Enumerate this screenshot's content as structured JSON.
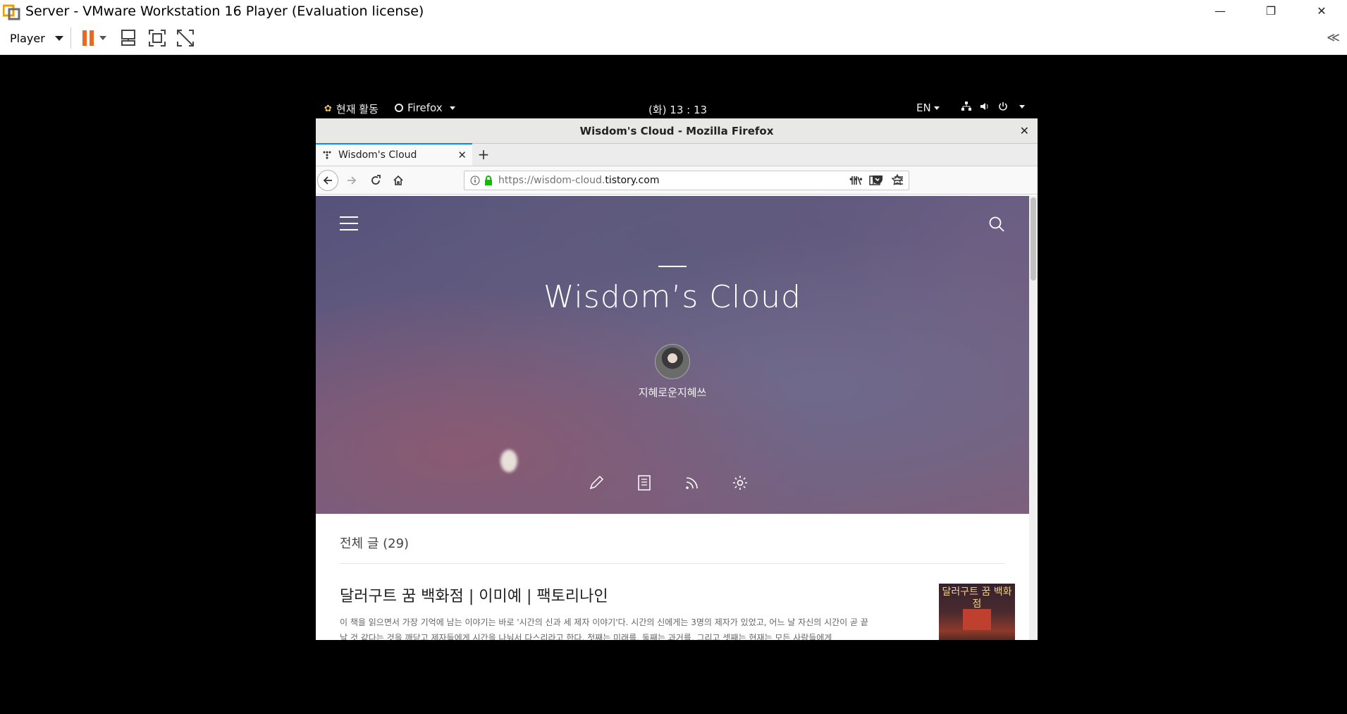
{
  "vm": {
    "title": "Server - VMware Workstation 16 Player (Evaluation license)",
    "player_label": "Player",
    "collapse_label": "≪"
  },
  "gnome": {
    "activities": "현재 활동",
    "app_menu": "Firefox",
    "clock": "(화) 13 : 13",
    "lang": "EN"
  },
  "firefox": {
    "window_title": "Wisdom's Cloud - Mozilla Firefox",
    "tab_label": "Wisdom's Cloud",
    "url_prefix": "https://wisdom-cloud.",
    "url_domain": "tistory.com",
    "url_actions": "•••"
  },
  "blog": {
    "title": "Wisdom’s Cloud",
    "author": "지혜로운지혜쓰",
    "count": "전체 글 (29)",
    "post": {
      "title": "달러구트 꿈 백화점 | 이미예 | 팩토리나인",
      "excerpt": "이 책을 읽으면서 가장 기억에 남는 이야기는 바로 '시간의 신과 세 제자 이야기'다. 시간의 신에게는 3명의 제자가 있었고, 어느 날 자신의 시간이 곧 끝날 것 같다는 것을 깨닫고 제자들에게 시간을 나눠서 다스리라고 한다. 첫째는 미래를, 둘째는 과거를, 그리고 셋째는 현재는 모든 사람들에게",
      "thumb_text": "달러구트 꿈 백화점"
    }
  },
  "colors": {
    "pause": "#e8691f",
    "tab_accent": "#0a84ff",
    "lock": "#12bc00"
  }
}
